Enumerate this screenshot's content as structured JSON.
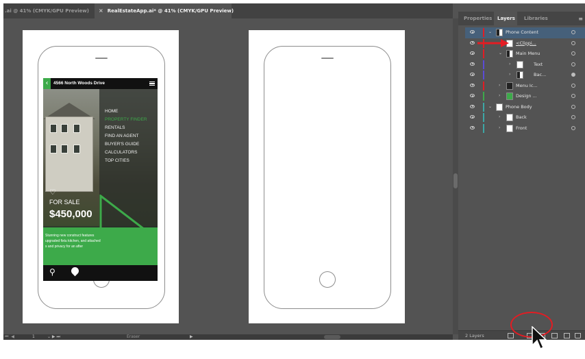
{
  "document_tabs": [
    {
      "label": ".ai @ 41% (CMYK/GPU Preview)",
      "active": false
    },
    {
      "label": "RealEstateApp.ai* @ 41% (CMYK/GPU Preview)",
      "active": true,
      "close_icon": "×"
    }
  ],
  "app_screen": {
    "address": "4566 North Woods Drive",
    "menu_items": [
      "HOME",
      "PROPERTY FINDER",
      "RENTALS",
      "FIND AN AGENT",
      "BUYER'S GUIDE",
      "CALCULATORS",
      "TOP CITIES"
    ],
    "active_menu_item": "PROPERTY FINDER",
    "heart_icon": "♡",
    "status": "FOR SALE",
    "price": "$450,000",
    "description": "Stunning new construct features upgraded fixtu kitchen, and attached s and privacy for an after",
    "accent_color": "#3daa4a",
    "search_icon": "search-icon",
    "pin_icon": "location-pin-icon"
  },
  "status_bar": {
    "nav_prev": "⏮ ◀",
    "page": "1",
    "nav_next": "⌄ ▶ ⏭",
    "tool": "Eraser",
    "play": "▶"
  },
  "panel": {
    "tabs": [
      "Properties",
      "Layers",
      "Libraries"
    ],
    "active_tab": "Layers",
    "menu_icon": "≡",
    "layers": [
      {
        "name": "Phone Content",
        "color": "#e31c23",
        "expanded": true,
        "selected": true,
        "thumb": "split"
      },
      {
        "name": "<Clippi...",
        "color": "#e31c23",
        "expanded": false,
        "selected": false,
        "thumb": "white"
      },
      {
        "name": "Main Menu",
        "color": "#e31c23",
        "expanded": true,
        "selected": false,
        "thumb": "split"
      },
      {
        "name": "Text",
        "color": "#5b4bd6",
        "expanded": false,
        "selected": false,
        "thumb": "white"
      },
      {
        "name": "Bac...",
        "color": "#5b4bd6",
        "expanded": false,
        "selected": false,
        "thumb": "split"
      },
      {
        "name": "Menu Ic...",
        "color": "#e31c23",
        "expanded": false,
        "selected": false,
        "thumb": "dark"
      },
      {
        "name": "Design ...",
        "color": "#3daa4a",
        "expanded": false,
        "selected": false,
        "thumb": "green"
      },
      {
        "name": "Phone Body",
        "color": "#3daa4a",
        "expanded": true,
        "selected": false,
        "thumb": "white"
      },
      {
        "name": "Back",
        "color": "#3da7a6",
        "expanded": false,
        "selected": false,
        "thumb": "white"
      },
      {
        "name": "Front",
        "color": "#3da7a6",
        "expanded": false,
        "selected": false,
        "thumb": "white"
      }
    ],
    "layer_count": "2 Layers"
  }
}
